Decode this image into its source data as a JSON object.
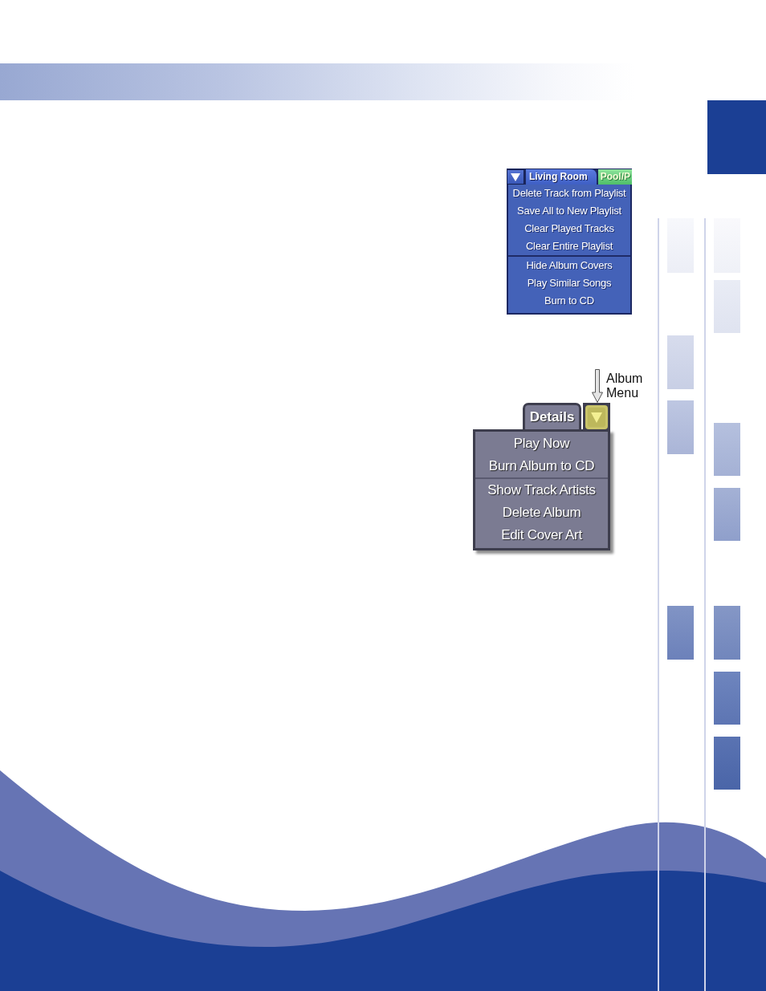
{
  "playlist_menu": {
    "tabs": [
      {
        "label": "Living Room",
        "selected": true
      },
      {
        "label": "Pool/P",
        "selected": false
      }
    ],
    "sections": [
      {
        "items": [
          "Delete Track from Playlist",
          "Save All to New Playlist",
          "Clear Played Tracks",
          "Clear Entire Playlist"
        ]
      },
      {
        "items": [
          "Hide Album Covers",
          "Play Similar Songs",
          "Burn to CD"
        ]
      }
    ]
  },
  "callout": {
    "label": "Album Menu"
  },
  "album_menu": {
    "tabs": [
      {
        "label": "Details",
        "selected": true
      }
    ],
    "sections": [
      {
        "items": [
          "Play Now",
          "Burn Album to CD"
        ]
      },
      {
        "items": [
          "Show Track Artists",
          "Delete Album",
          "Edit Cover Art"
        ]
      }
    ]
  }
}
